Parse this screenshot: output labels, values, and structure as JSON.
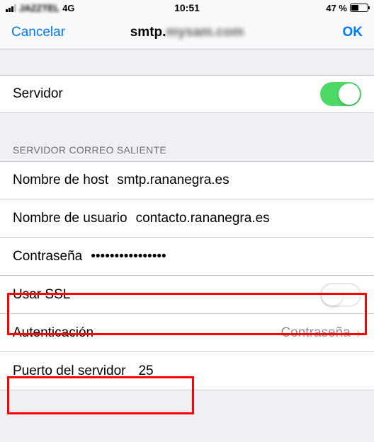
{
  "status_bar": {
    "carrier": "JAZZTEL",
    "network": "4G",
    "time": "10:51",
    "battery_pct": "47 %"
  },
  "nav": {
    "left": "Cancelar",
    "title_prefix": "smtp.",
    "title_blurred": "mysam.com",
    "right": "OK"
  },
  "sections": {
    "servidor": {
      "label": "Servidor",
      "on": true
    },
    "saliente_header": "Servidor correo saliente",
    "hostname": {
      "label": "Nombre de host",
      "value": "smtp.rananegra.es"
    },
    "username": {
      "label": "Nombre de usuario",
      "value": "contacto.rananegra.es"
    },
    "password": {
      "label": "Contraseña",
      "value": "••••••••••••••••"
    },
    "use_ssl": {
      "label": "Usar SSL",
      "on": false
    },
    "auth": {
      "label": "Autenticación",
      "value": "Contraseña"
    },
    "port": {
      "label": "Puerto del servidor",
      "value": "25"
    }
  }
}
